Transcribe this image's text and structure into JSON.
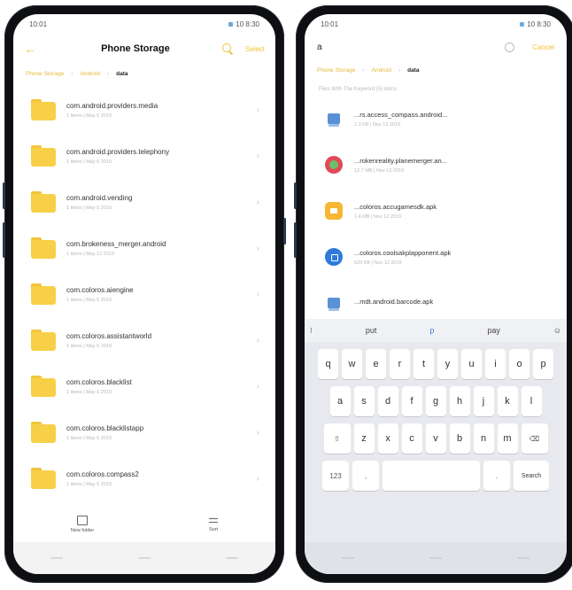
{
  "left": {
    "status": {
      "time": "10:01",
      "right": "10 8:30"
    },
    "header": {
      "title": "Phone Storage",
      "select_label": "Select"
    },
    "crumbs": [
      "Phone Storage",
      "Android",
      "data"
    ],
    "items": [
      {
        "name": "com.android.providers.media",
        "meta": "1 items | May 5 2019"
      },
      {
        "name": "com.android.providers.telephony",
        "meta": "1 items | May 6 2019"
      },
      {
        "name": "com.android.vending",
        "meta": "1 items | May 5 2019"
      },
      {
        "name": "com.brokeness_merger.android",
        "meta": "1 items | May 12 2019"
      },
      {
        "name": "com.coloros.aiengine",
        "meta": "1 items | May 6 2019"
      },
      {
        "name": "com.coloros.assistantworld",
        "meta": "1 items | May 6 2019"
      },
      {
        "name": "com.coloros.blacklist",
        "meta": "1 items | May 6 2019"
      },
      {
        "name": "com.coloros.blacklistapp",
        "meta": "1 items | May 6 2019"
      },
      {
        "name": "com.coloros.compass2",
        "meta": "1 items | May 6 2019"
      }
    ],
    "bottom": {
      "new_folder": "New folder",
      "sort": "Sort"
    }
  },
  "right": {
    "status": {
      "time": "10:01",
      "right": "10 8:30"
    },
    "search": {
      "query": "a",
      "cancel_label": "Cancel"
    },
    "crumbs": [
      "Phone Storage",
      "Android",
      "data"
    ],
    "note": "Files With The Keyword (5) items",
    "results": [
      {
        "name": "...rs.access_compass.android...",
        "meta": "1.3 KB | Nov 12 2019",
        "icon": "document-icon"
      },
      {
        "name": "...rokenreality.planemerger.an...",
        "meta": "12.7 MB | Nov 12 2019",
        "icon": "rose-icon"
      },
      {
        "name": "...coloros.accugamesdk.apk",
        "meta": "1.4 MB | Nov 12 2019",
        "icon": "game-icon"
      },
      {
        "name": "...coloros.coolsakplapponent.apk",
        "meta": "520 KB | Nov 12 2019",
        "icon": "lock-icon"
      },
      {
        "name": "...mdt.android.barcode.apk",
        "meta": "",
        "icon": "document-icon"
      }
    ],
    "keyboard": {
      "suggestions": [
        "put",
        "p",
        "pay"
      ],
      "row1": [
        "q",
        "w",
        "e",
        "r",
        "t",
        "y",
        "u",
        "i",
        "o",
        "p"
      ],
      "row2": [
        "a",
        "s",
        "d",
        "f",
        "g",
        "h",
        "j",
        "k",
        "l"
      ],
      "row3": [
        "z",
        "x",
        "c",
        "v",
        "b",
        "n",
        "m"
      ],
      "numbers_label": "123",
      "search_label": "Search"
    }
  }
}
